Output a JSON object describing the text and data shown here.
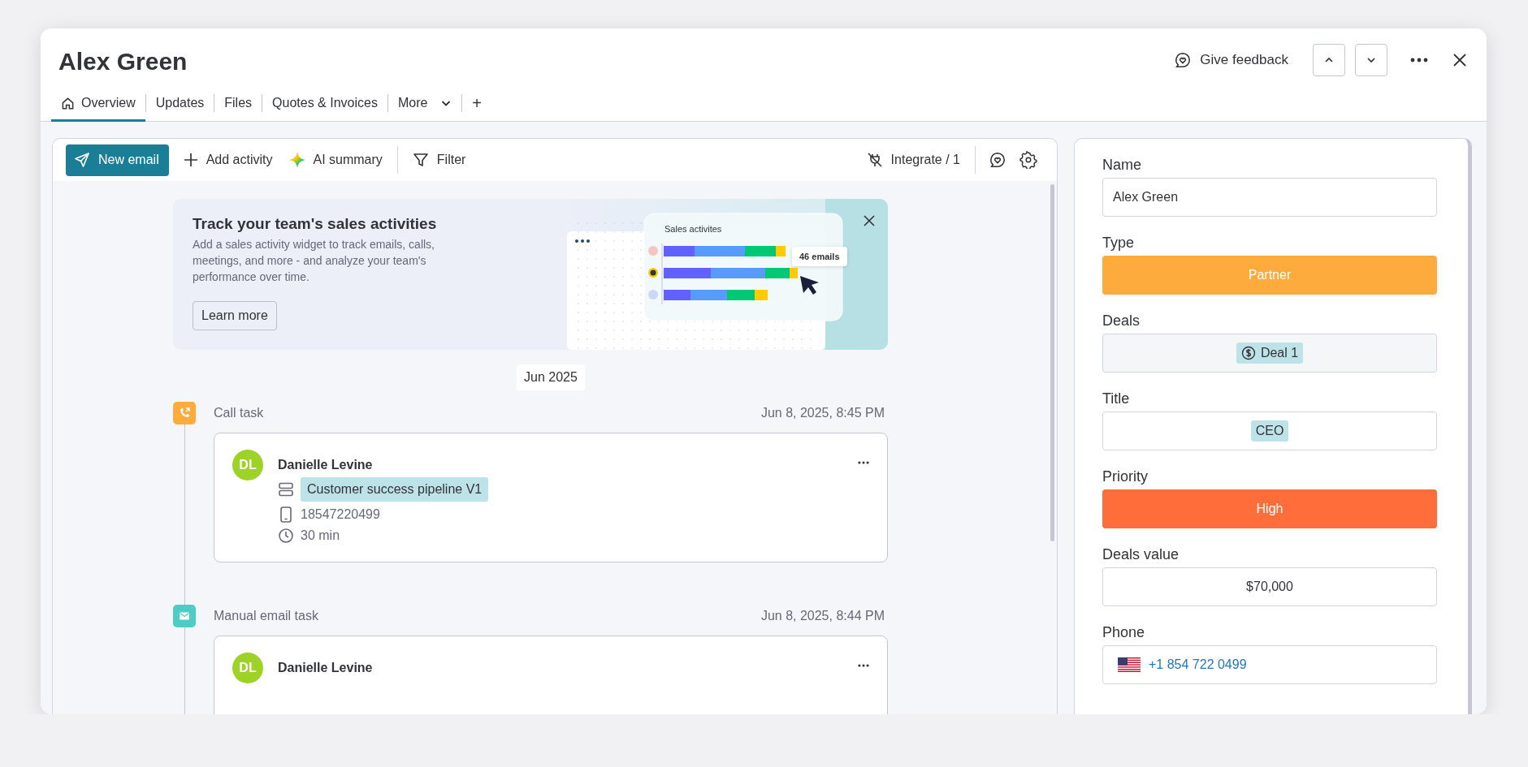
{
  "window": {
    "title": "Alex Green"
  },
  "header_actions": {
    "feedback": "Give feedback"
  },
  "tabs": [
    {
      "label": "Overview",
      "kind": "home",
      "selected": true
    },
    {
      "label": "Updates",
      "kind": "plain",
      "selected": false
    },
    {
      "label": "Files",
      "kind": "plain",
      "selected": false
    },
    {
      "label": "Quotes & Invoices",
      "kind": "plain",
      "selected": false
    },
    {
      "label": "More",
      "kind": "dropdown",
      "selected": false
    },
    {
      "label": "+",
      "kind": "add",
      "selected": false
    }
  ],
  "toolbar": {
    "new_email": "New email",
    "add_activity": "Add activity",
    "ai_summary": "AI summary",
    "filter": "Filter",
    "integrate": "Integrate / 1"
  },
  "banner": {
    "title": "Track your team's sales activities",
    "body": "Add a sales activity widget to track emails, calls, meetings, and more - and analyze your team's performance over time.",
    "button": "Learn more",
    "widget_title": "Sales activites",
    "tooltip": "46 emails"
  },
  "date_pill": "Jun 2025",
  "timeline": [
    {
      "kind": "call",
      "label": "Call task",
      "time": "Jun 8, 2025, 8:45 PM",
      "initials": "DL",
      "name": "Danielle Levine",
      "pipeline": "Customer success pipeline V1",
      "phone": "18547220499",
      "duration": "30 min"
    },
    {
      "kind": "email",
      "label": "Manual email task",
      "time": "Jun 8, 2025, 8:44 PM",
      "initials": "DL",
      "name": "Danielle Levine"
    }
  ],
  "fields": [
    {
      "label": "Name",
      "kind": "text",
      "value": "Alex Green"
    },
    {
      "label": "Type",
      "kind": "status",
      "value": "Partner",
      "color": "#fdab3d"
    },
    {
      "label": "Deals",
      "kind": "link",
      "value": "Deal 1"
    },
    {
      "label": "Title",
      "kind": "tag",
      "value": "CEO"
    },
    {
      "label": "Priority",
      "kind": "status",
      "value": "High",
      "color": "#ff6d3b"
    },
    {
      "label": "Deals value",
      "kind": "number",
      "value": "$70,000"
    },
    {
      "label": "Phone",
      "kind": "phone",
      "value": "+1 854 722 0499"
    }
  ]
}
